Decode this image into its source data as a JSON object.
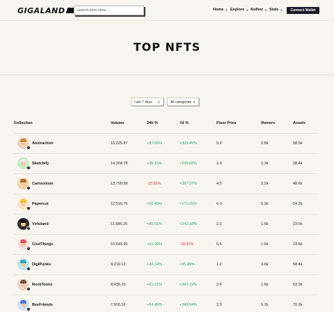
{
  "header": {
    "logo": "GIGALAND",
    "search_placeholder": "search item here...",
    "nav": [
      {
        "label": "Home"
      },
      {
        "label": "Explore"
      },
      {
        "label": "Author"
      },
      {
        "label": "Stats"
      }
    ],
    "connect_label": "Connect Wallet"
  },
  "hero": {
    "title": "TOP NFTS"
  },
  "filters": [
    {
      "value": "Last 7 days"
    },
    {
      "value": "All categories"
    }
  ],
  "table": {
    "columns": [
      "Collection",
      "Volume",
      "24h %",
      "7d %",
      "Floor Price",
      "Owners",
      "Assets"
    ],
    "rows": [
      {
        "collection": "Abstraction",
        "volume": "15,225.87",
        "change_24h": "+87.56%",
        "change_7d": "+309.45%",
        "floor": "5.9",
        "owners": "2.8k",
        "assets": "58.5k",
        "trend_24h": "up",
        "trend_7d": "up",
        "avatar_bg": "#e9d3bf",
        "hair": "#c98a3d"
      },
      {
        "collection": "Sketchify",
        "volume": "14,304.78",
        "change_24h": "+35.11%",
        "change_7d": "+239.83%",
        "floor": "2.9",
        "owners": "2.3k",
        "assets": "28.4k",
        "trend_24h": "up",
        "trend_7d": "up",
        "avatar_bg": "#c6ecc6",
        "hair": "#e8e8e8"
      },
      {
        "collection": "Cartoonism",
        "volume": "13,705.58",
        "change_24h": "-33.55%",
        "change_7d": "+397.97%",
        "floor": "4.5",
        "owners": "2.2k",
        "assets": "48.6k",
        "trend_24h": "down",
        "trend_7d": "up",
        "avatar_bg": "#f2d3a6",
        "hair": "#a86a2a"
      },
      {
        "collection": "Papercut",
        "volume": "12,516.75",
        "change_24h": "+23.45%",
        "change_7d": "+171.25%",
        "floor": "6.3",
        "owners": "5.3k",
        "assets": "54.2k",
        "trend_24h": "up",
        "trend_7d": "up",
        "avatar_bg": "#f9e4c6",
        "hair": "#f0c23a"
      },
      {
        "collection": "Virtuland",
        "volume": "11,586.26",
        "change_24h": "+80.91%",
        "change_7d": "+241.18%",
        "floor": "2.2",
        "owners": "1.6k",
        "assets": "23.5k",
        "trend_24h": "up",
        "trend_7d": "up",
        "avatar_bg": "#2d2d2d",
        "hair": "#111111"
      },
      {
        "collection": "CoolThings",
        "volume": "10,645.95",
        "change_24h": "+51.99%",
        "change_7d": "-29.82%",
        "floor": "6.6",
        "owners": "1.6k",
        "assets": "23.6k",
        "trend_24h": "up",
        "trend_7d": "down",
        "avatar_bg": "#f6dede",
        "hair": "#d9535f"
      },
      {
        "collection": "DigiPunks",
        "volume": "9,219.13",
        "change_24h": "+42.24%",
        "change_7d": "+95.45%",
        "floor": "1.2",
        "owners": "3.6k",
        "assets": "58.4k",
        "trend_24h": "up",
        "trend_7d": "up",
        "avatar_bg": "#bfe6ec",
        "hair": "#3aa7b8"
      },
      {
        "collection": "RockToonz",
        "volume": "8,436.15",
        "change_24h": "+61.31%",
        "change_7d": "+347.19%",
        "floor": "2.4",
        "owners": "1.6k",
        "assets": "63.3k",
        "trend_24h": "up",
        "trend_7d": "up",
        "avatar_bg": "#e8d6c8",
        "hair": "#6b4a3a"
      },
      {
        "collection": "BeeFriends",
        "volume": "7,505.16",
        "change_24h": "+64.46%",
        "change_7d": "+240.94%",
        "floor": "2.3",
        "owners": "5.2k",
        "assets": "70.3k",
        "trend_24h": "up",
        "trend_7d": "up",
        "avatar_bg": "#cfe0f7",
        "hair": "#4a78c8"
      }
    ]
  },
  "colors": {
    "background": "#f8f5f0",
    "accent_dark": "#1a1a2a",
    "positive": "#1fa56a",
    "negative": "#e0343f"
  },
  "icons": {
    "chevron": "chevron-down-icon",
    "verified": "verified-badge-icon"
  }
}
